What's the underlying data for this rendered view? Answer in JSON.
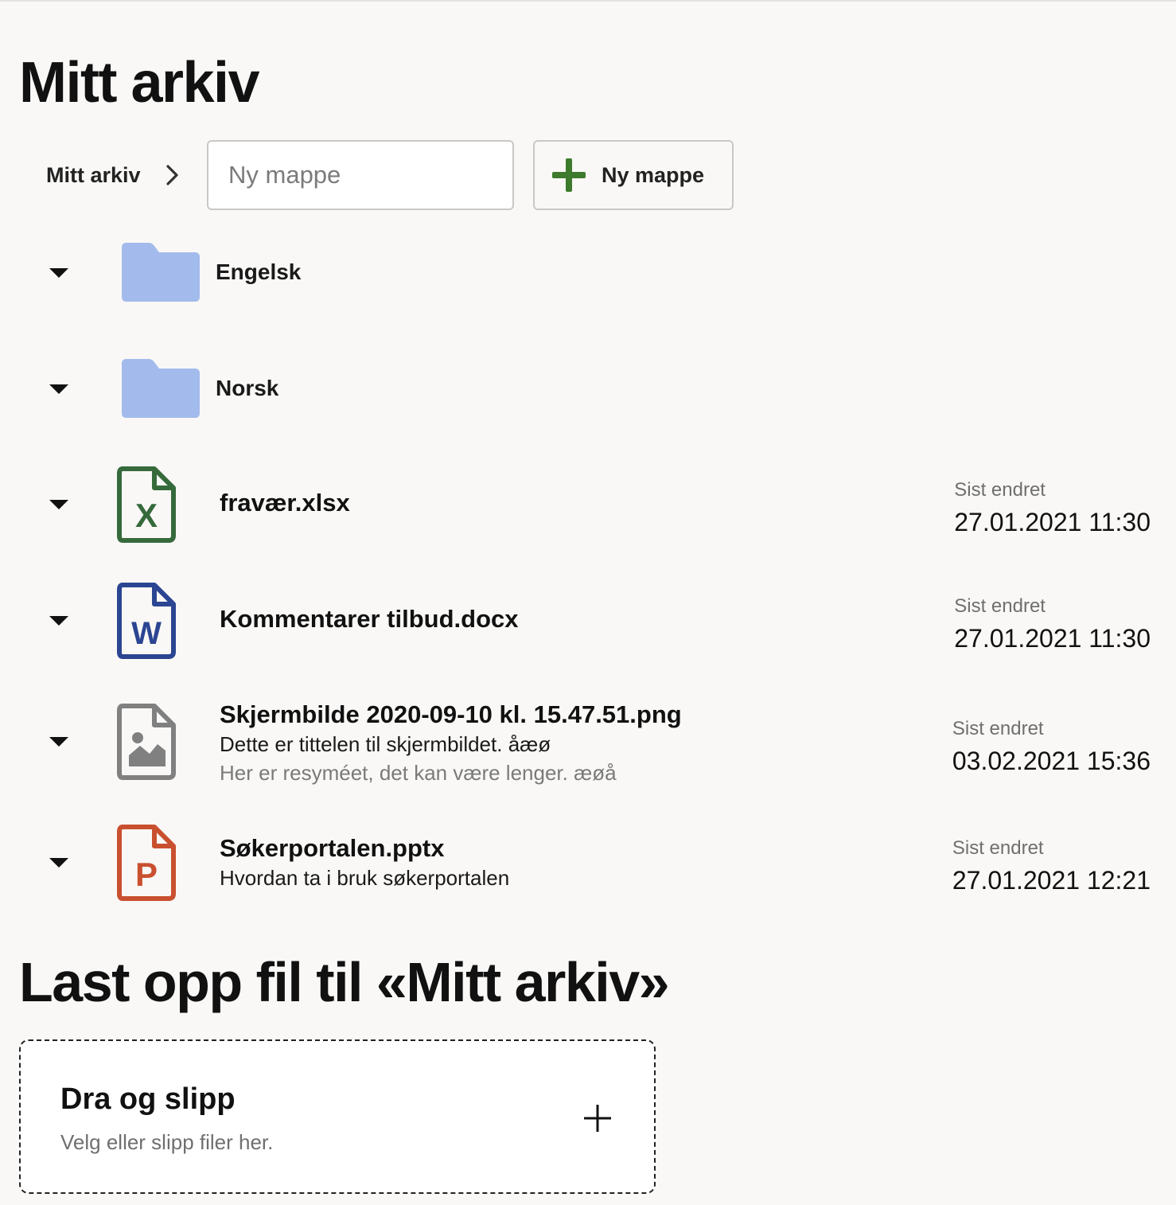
{
  "page": {
    "title": "Mitt arkiv"
  },
  "breadcrumb": {
    "root_label": "Mitt arkiv"
  },
  "new_folder": {
    "input_value": "",
    "input_placeholder": "Ny mappe",
    "button_label": "Ny mappe"
  },
  "folders": [
    {
      "name": "Engelsk",
      "icon": "folder-icon"
    },
    {
      "name": "Norsk",
      "icon": "folder-icon"
    }
  ],
  "files": [
    {
      "name": "fravær.xlsx",
      "icon": "excel-file-icon",
      "meta_label": "Sist endret",
      "modified": "27.01.2021 11:30"
    },
    {
      "name": "Kommentarer tilbud.docx",
      "icon": "word-file-icon",
      "meta_label": "Sist endret",
      "modified": "27.01.2021 11:30"
    },
    {
      "name": "Skjermbilde 2020-09-10 kl. 15.47.51.png",
      "subtitle": "Dette er tittelen til skjermbildet. åæø",
      "description": "Her er resyméet, det kan være lenger. æøå",
      "icon": "image-file-icon",
      "meta_label": "Sist endret",
      "modified": "03.02.2021 15:36"
    },
    {
      "name": "Søkerportalen.pptx",
      "subtitle": "Hvordan ta i bruk søkerportalen",
      "icon": "powerpoint-file-icon",
      "meta_label": "Sist endret",
      "modified": "27.01.2021 12:21"
    }
  ],
  "upload": {
    "title": "Last opp fil til «Mitt arkiv»",
    "dropzone_title": "Dra og slipp",
    "dropzone_hint": "Velg eller slipp filer her."
  },
  "colors": {
    "background": "#f9f8f6",
    "folder": "#a3bbec",
    "excel": "#366a3b",
    "word": "#2b4592",
    "image": "#808080",
    "powerpoint": "#c9502f",
    "add_green": "#3d7a2c"
  }
}
